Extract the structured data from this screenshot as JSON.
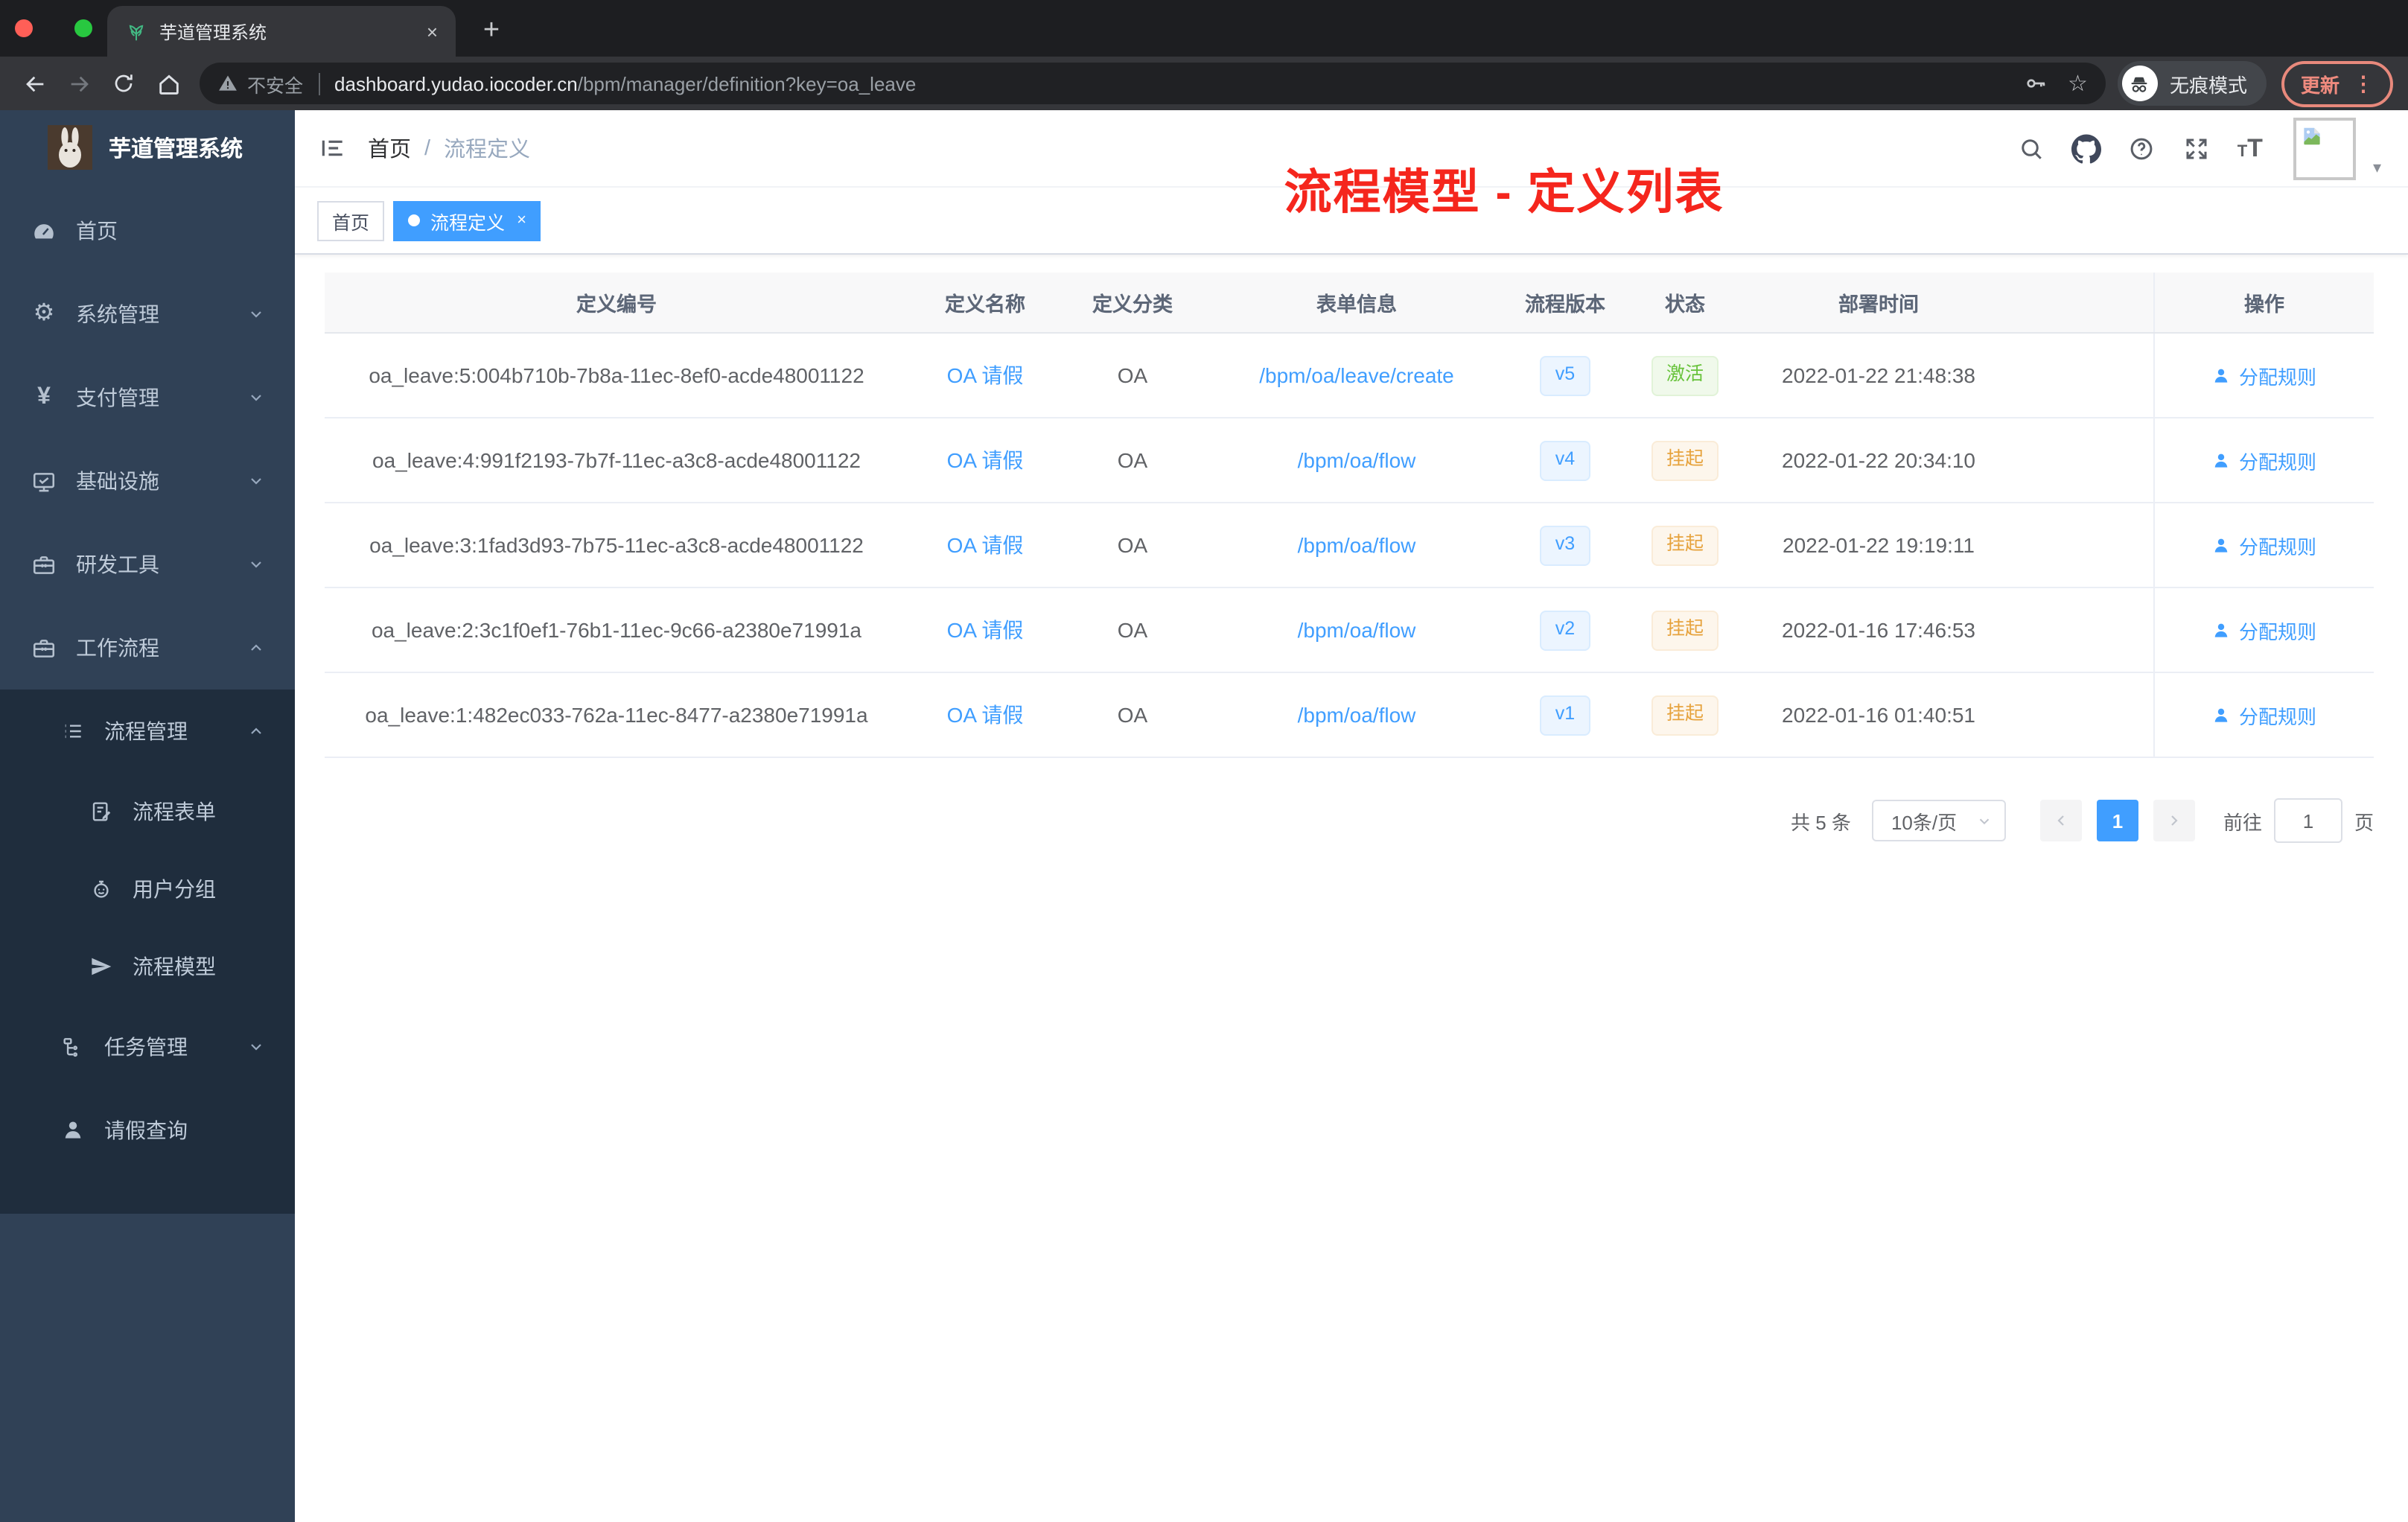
{
  "browser": {
    "tab_title": "芋道管理系统",
    "security_label": "不安全",
    "url_host": "dashboard.yudao.iocoder.cn",
    "url_path": "/bpm/manager/definition?key=oa_leave",
    "incognito_label": "无痕模式",
    "update_label": "更新"
  },
  "icons": {
    "gear": "⚙",
    "yen": "¥",
    "star": "☆",
    "close": "×",
    "plus": "+",
    "kebab": "⋮",
    "caret_down": "▾",
    "slash": "/",
    "font_size_small": "T",
    "font_size_large": "T"
  },
  "sidebar": {
    "app_title": "芋道管理系统",
    "items": [
      {
        "label": "首页",
        "icon": "dashboard-icon"
      },
      {
        "label": "系统管理",
        "icon": "gear-icon",
        "chevron": "down"
      },
      {
        "label": "支付管理",
        "icon": "yen-icon",
        "chevron": "down"
      },
      {
        "label": "基础设施",
        "icon": "monitor-icon",
        "chevron": "down"
      },
      {
        "label": "研发工具",
        "icon": "toolbox-icon",
        "chevron": "down"
      },
      {
        "label": "工作流程",
        "icon": "toolbox-icon",
        "chevron": "up"
      }
    ],
    "submenu": {
      "group_label": "流程管理",
      "group_chevron": "up",
      "children": [
        "流程表单",
        "用户分组",
        "流程模型"
      ],
      "siblings": [
        {
          "label": "任务管理",
          "chevron": "down"
        },
        {
          "label": "请假查询"
        }
      ]
    }
  },
  "header": {
    "breadcrumb": [
      "首页",
      "流程定义"
    ],
    "annotation": "流程模型 - 定义列表"
  },
  "tags": [
    {
      "label": "首页",
      "active": false
    },
    {
      "label": "流程定义",
      "active": true
    }
  ],
  "table": {
    "columns": [
      "定义编号",
      "定义名称",
      "定义分类",
      "表单信息",
      "流程版本",
      "状态",
      "部署时间",
      "操作"
    ],
    "rows": [
      {
        "id": "oa_leave:5:004b710b-7b8a-11ec-8ef0-acde48001122",
        "name": "OA 请假",
        "category": "OA",
        "form": "/bpm/oa/leave/create",
        "version": "v5",
        "status": "激活",
        "status_type": "success",
        "deploy_time": "2022-01-22 21:48:38",
        "action": "分配规则"
      },
      {
        "id": "oa_leave:4:991f2193-7b7f-11ec-a3c8-acde48001122",
        "name": "OA 请假",
        "category": "OA",
        "form": "/bpm/oa/flow",
        "version": "v4",
        "status": "挂起",
        "status_type": "warning",
        "deploy_time": "2022-01-22 20:34:10",
        "action": "分配规则"
      },
      {
        "id": "oa_leave:3:1fad3d93-7b75-11ec-a3c8-acde48001122",
        "name": "OA 请假",
        "category": "OA",
        "form": "/bpm/oa/flow",
        "version": "v3",
        "status": "挂起",
        "status_type": "warning",
        "deploy_time": "2022-01-22 19:19:11",
        "action": "分配规则"
      },
      {
        "id": "oa_leave:2:3c1f0ef1-76b1-11ec-9c66-a2380e71991a",
        "name": "OA 请假",
        "category": "OA",
        "form": "/bpm/oa/flow",
        "version": "v2",
        "status": "挂起",
        "status_type": "warning",
        "deploy_time": "2022-01-16 17:46:53",
        "action": "分配规则"
      },
      {
        "id": "oa_leave:1:482ec033-762a-11ec-8477-a2380e71991a",
        "name": "OA 请假",
        "category": "OA",
        "form": "/bpm/oa/flow",
        "version": "v1",
        "status": "挂起",
        "status_type": "warning",
        "deploy_time": "2022-01-16 01:40:51",
        "action": "分配规则"
      }
    ]
  },
  "pagination": {
    "total_label": "共 5 条",
    "page_size": "10条/页",
    "current_page": "1",
    "goto_label": "前往",
    "goto_value": "1",
    "goto_suffix": "页"
  },
  "colors": {
    "accent": "#409eff",
    "tag_active": "#409eff",
    "sidebar_bg": "#304156",
    "submenu_bg": "#1f2d3d",
    "success": "#67c23a",
    "warning": "#e6a23c",
    "annotation": "#f5261d"
  }
}
